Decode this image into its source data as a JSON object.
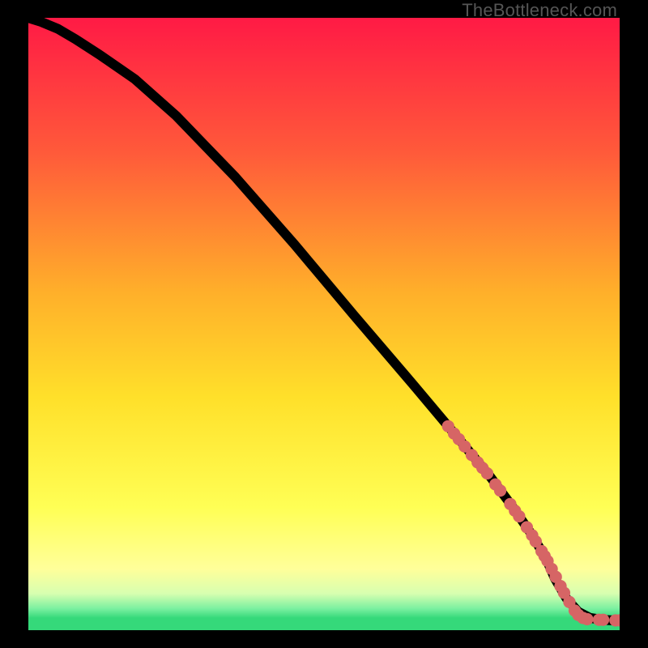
{
  "watermark": "TheBottleneck.com",
  "colors": {
    "frame_bg": "#000000",
    "curve": "#000000",
    "marker": "#d66565",
    "gradient_top": "#ff1a45",
    "gradient_mid1": "#ff8c2a",
    "gradient_mid2": "#ffe02a",
    "gradient_bottom_yellow": "#ffff6a",
    "gradient_green": "#48e27a"
  },
  "chart_data": {
    "type": "line",
    "title": "",
    "xlabel": "",
    "ylabel": "",
    "xlim": [
      0,
      100
    ],
    "ylim": [
      0,
      100
    ],
    "series": [
      {
        "name": "bottleneck-curve",
        "x": [
          0,
          2,
          5,
          8,
          12,
          18,
          25,
          35,
          45,
          55,
          65,
          73,
          78,
          82,
          85,
          87.5,
          89,
          91,
          93,
          95,
          97,
          99,
          100
        ],
        "y": [
          100,
          99.4,
          98.2,
          96.5,
          94,
          90,
          84,
          74,
          63,
          51.5,
          40.2,
          31,
          25.2,
          20,
          15.8,
          11.8,
          8.5,
          5.2,
          3.0,
          2.0,
          1.7,
          1.6,
          1.6
        ]
      }
    ],
    "markers": {
      "name": "highlighted-points",
      "points": [
        {
          "x": 71.0,
          "y": 33.3
        },
        {
          "x": 72.0,
          "y": 32.1
        },
        {
          "x": 72.8,
          "y": 31.2
        },
        {
          "x": 73.8,
          "y": 30.0
        },
        {
          "x": 75.0,
          "y": 28.6
        },
        {
          "x": 76.0,
          "y": 27.4
        },
        {
          "x": 76.8,
          "y": 26.5
        },
        {
          "x": 77.6,
          "y": 25.6
        },
        {
          "x": 79.0,
          "y": 23.8
        },
        {
          "x": 79.8,
          "y": 22.8
        },
        {
          "x": 81.5,
          "y": 20.6
        },
        {
          "x": 82.3,
          "y": 19.5
        },
        {
          "x": 83.0,
          "y": 18.6
        },
        {
          "x": 84.3,
          "y": 16.8
        },
        {
          "x": 85.2,
          "y": 15.5
        },
        {
          "x": 85.8,
          "y": 14.5
        },
        {
          "x": 86.8,
          "y": 12.9
        },
        {
          "x": 87.3,
          "y": 12.1
        },
        {
          "x": 87.8,
          "y": 11.3
        },
        {
          "x": 88.5,
          "y": 10.0
        },
        {
          "x": 89.2,
          "y": 8.7
        },
        {
          "x": 90.0,
          "y": 7.2
        },
        {
          "x": 90.6,
          "y": 6.1
        },
        {
          "x": 91.5,
          "y": 4.6
        },
        {
          "x": 92.4,
          "y": 3.2
        },
        {
          "x": 93.0,
          "y": 2.5
        },
        {
          "x": 93.8,
          "y": 2.0
        },
        {
          "x": 94.5,
          "y": 1.8
        },
        {
          "x": 96.5,
          "y": 1.7
        },
        {
          "x": 97.2,
          "y": 1.7
        },
        {
          "x": 99.3,
          "y": 1.6
        },
        {
          "x": 100.0,
          "y": 1.6
        }
      ]
    }
  }
}
